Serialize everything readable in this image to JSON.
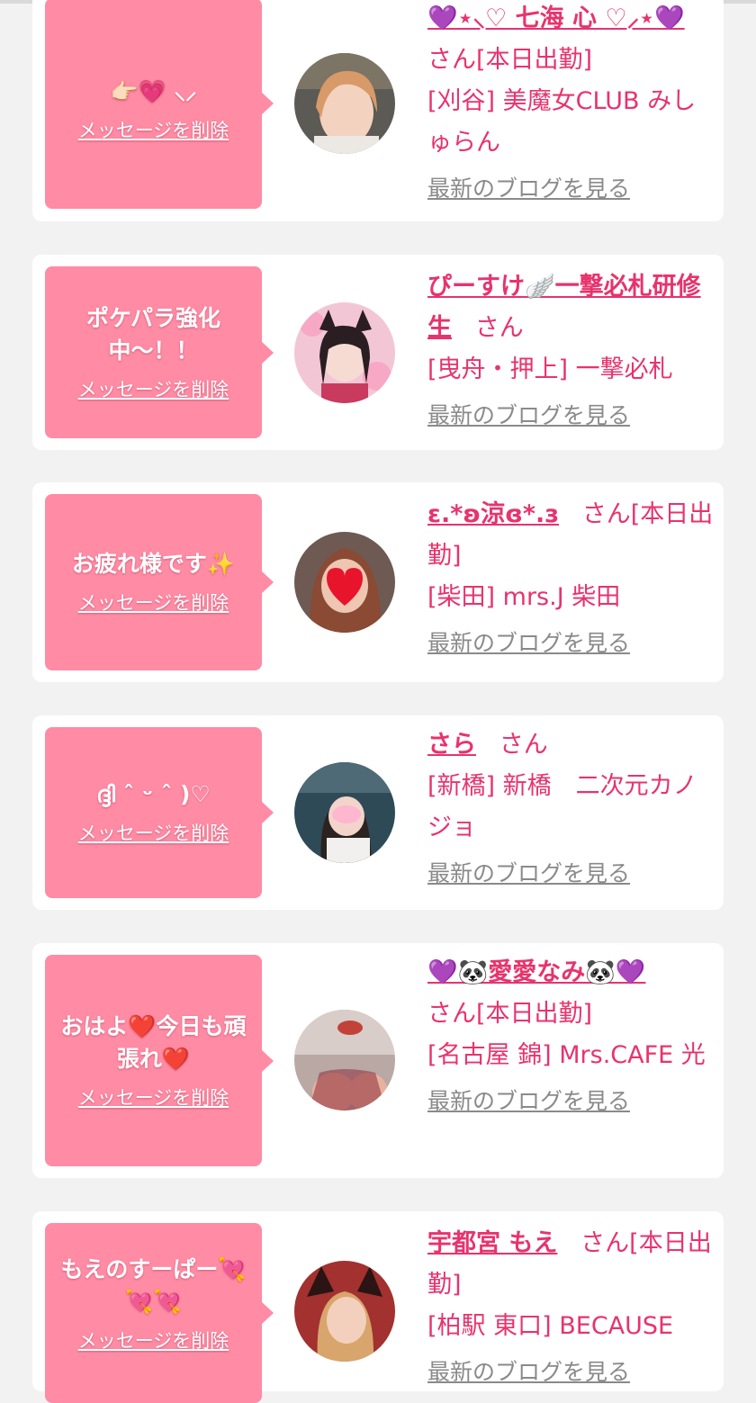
{
  "cards": [
    {
      "message": "👉🏻💗 ⸜⸝",
      "delete_label": "メッセージを削除",
      "name": "💜⋆⸜♡ 七海 心 ♡⸝⋆💜",
      "san": "さん[本日出勤]",
      "shop": "[刈谷] 美魔女CLUB みしゅらん",
      "blog": "最新のブログを見る"
    },
    {
      "message": "ポケパラ強化中〜！！",
      "delete_label": "メッセージを削除",
      "name": "ぴーすけ🪽一撃必札研修生",
      "san": "さん",
      "shop": "[曳舟・押上] 一撃必札",
      "blog": "最新のブログを見る"
    },
    {
      "message": "お疲れ様です✨",
      "delete_label": "メッセージを削除",
      "name": "ε.*ʚ涼ɞ*.з",
      "san": "さん[本日出勤]",
      "shop": "[柴田] mrs.J 柴田",
      "blog": "最新のブログを見る"
    },
    {
      "message": "ദ്ദി ˆ ᵕ ˆ )♡",
      "delete_label": "メッセージを削除",
      "name": "さら",
      "san": "さん",
      "shop": "[新橋] 新橋　二次元カノジョ",
      "blog": "最新のブログを見る"
    },
    {
      "message": "おはよ❤️今日も頑張れ❤️",
      "delete_label": "メッセージを削除",
      "name": "💜🐼愛愛なみ🐼💜",
      "san": "さん[本日出勤]",
      "shop": "[名古屋 錦] Mrs.CAFE 光",
      "blog": "最新のブログを見る"
    },
    {
      "message": "もえのすーぱー💘💘💘",
      "delete_label": "メッセージを削除",
      "name": "宇都宮 もえ",
      "san": "さん[本日出勤]",
      "shop": "[柏駅 東口] BECAUSE",
      "blog": "最新のブログを見る"
    }
  ],
  "colors": {
    "accent": "#e8336d",
    "bubble": "#ff8ba4",
    "link_gray": "#8a8a8a",
    "background": "#f2f2f2"
  }
}
